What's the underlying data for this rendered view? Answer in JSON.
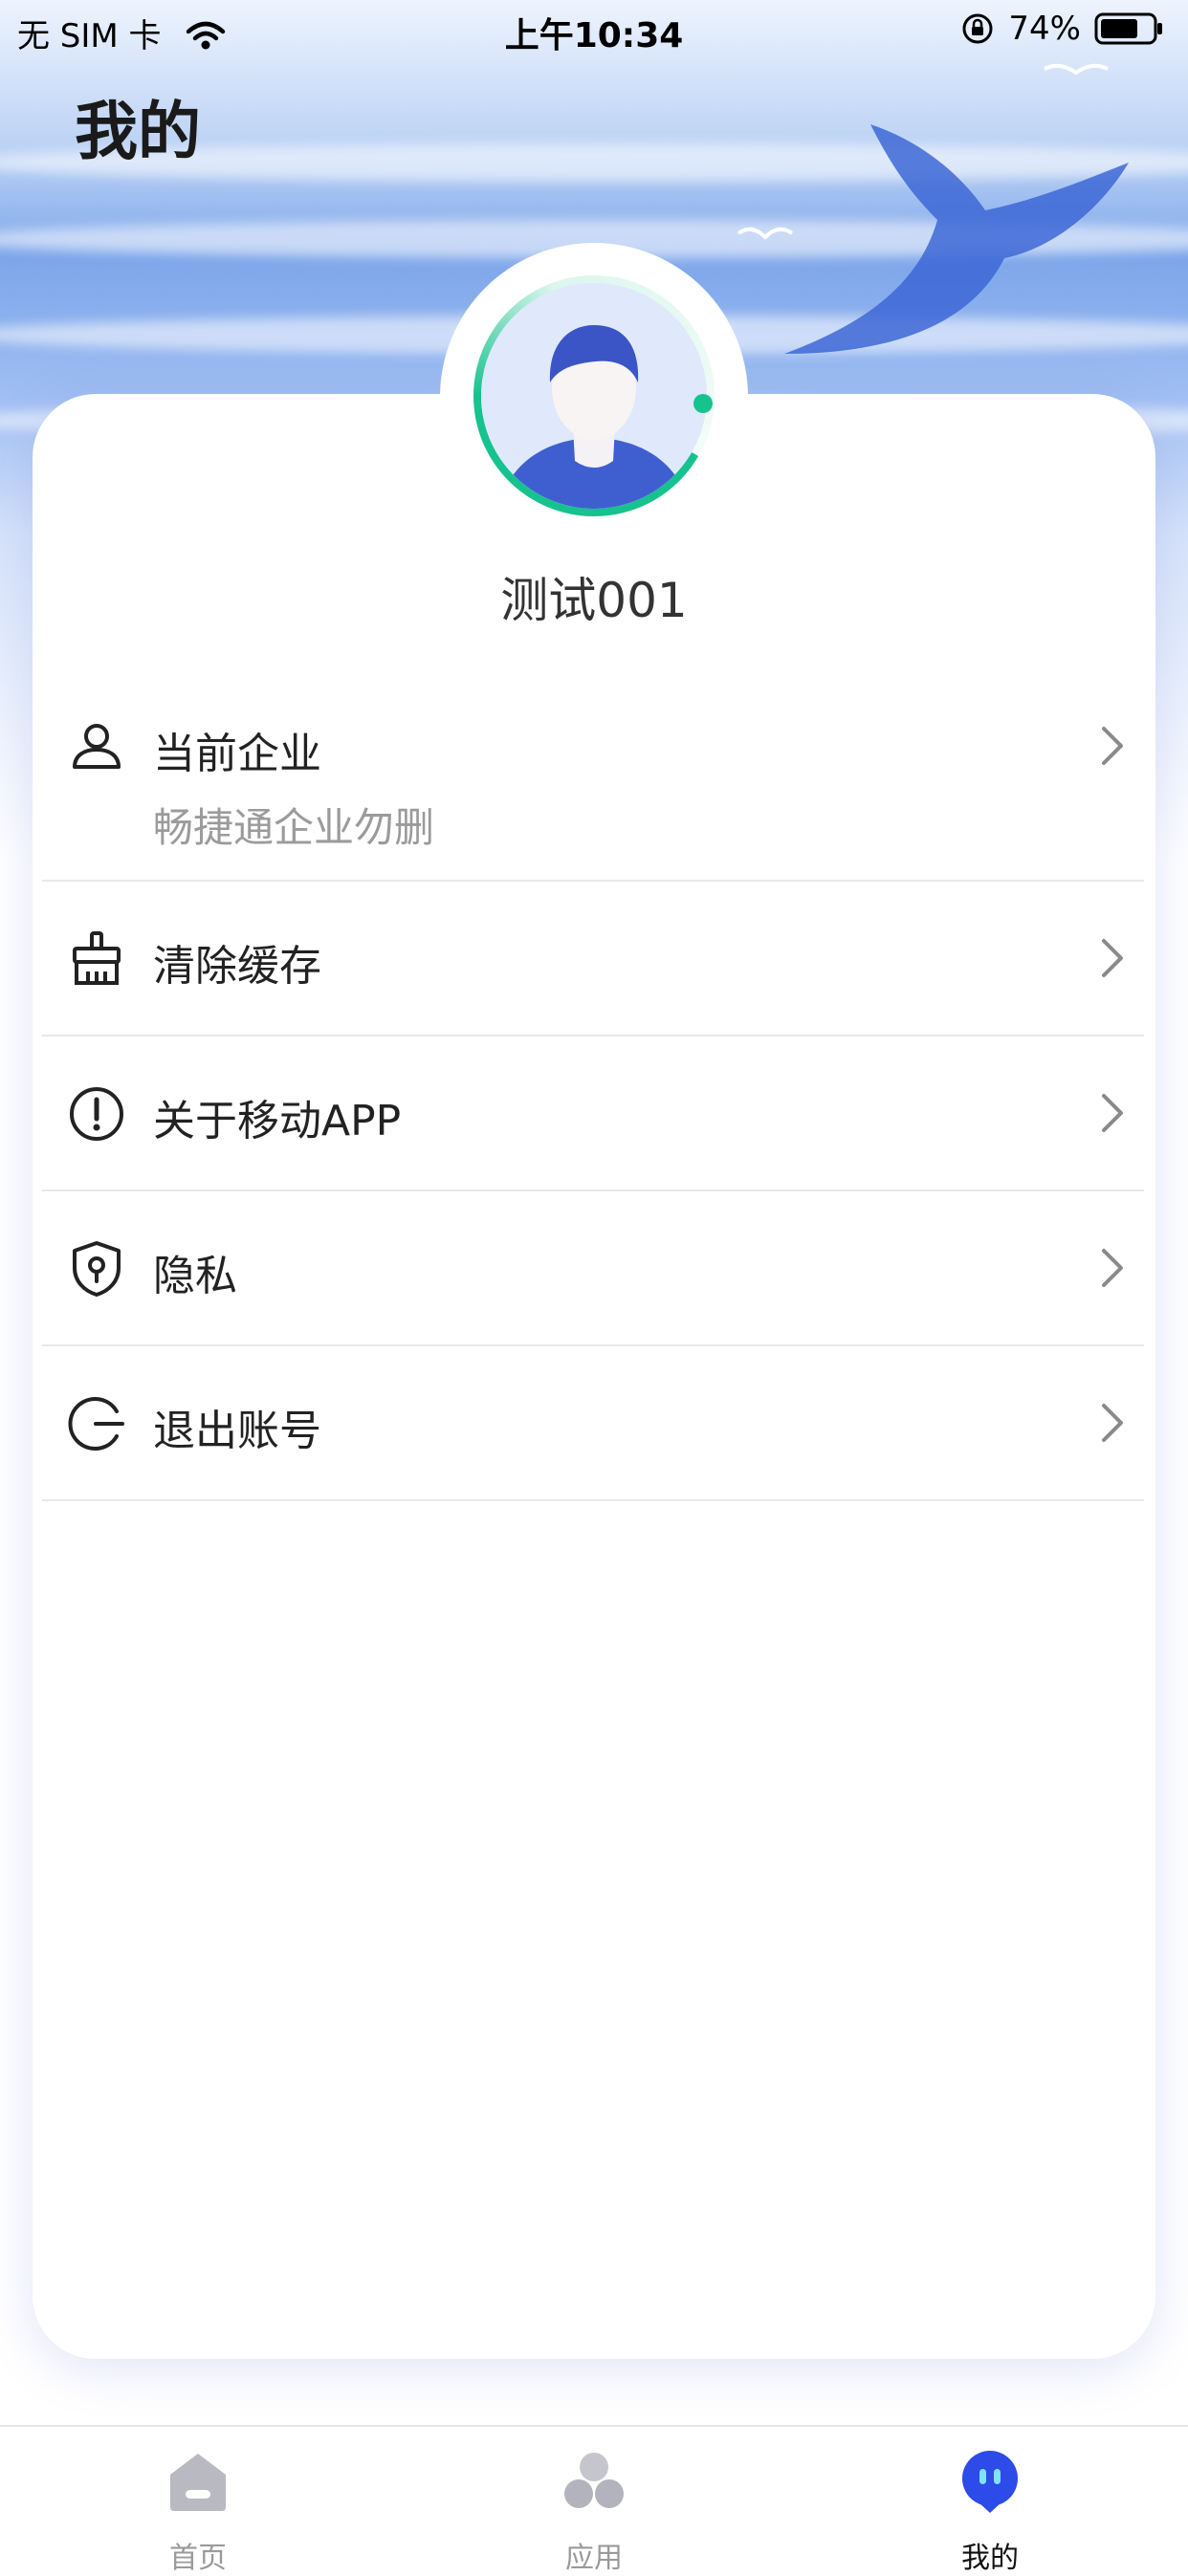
{
  "status_bar": {
    "carrier": "无 SIM 卡",
    "time": "上午10:34",
    "battery_percent": "74%",
    "battery_level": 0.74
  },
  "page": {
    "title": "我的"
  },
  "profile": {
    "username": "测试001"
  },
  "menu": [
    {
      "label": "当前企业",
      "sublabel": "畅捷通企业勿删",
      "icon": "user-icon"
    },
    {
      "label": "清除缓存",
      "icon": "broom-icon"
    },
    {
      "label": "关于移动APP",
      "icon": "info-icon"
    },
    {
      "label": "隐私",
      "icon": "shield-icon"
    },
    {
      "label": "退出账号",
      "icon": "logout-icon"
    }
  ],
  "tabbar": {
    "tabs": [
      {
        "label": "首页",
        "icon": "home-icon",
        "active": false
      },
      {
        "label": "应用",
        "icon": "apps-icon",
        "active": false
      },
      {
        "label": "我的",
        "icon": "robot-icon",
        "active": true
      }
    ]
  },
  "colors": {
    "accent": "#2d4be8",
    "ring": "#16c28e",
    "divider": "#e8e8ec"
  }
}
